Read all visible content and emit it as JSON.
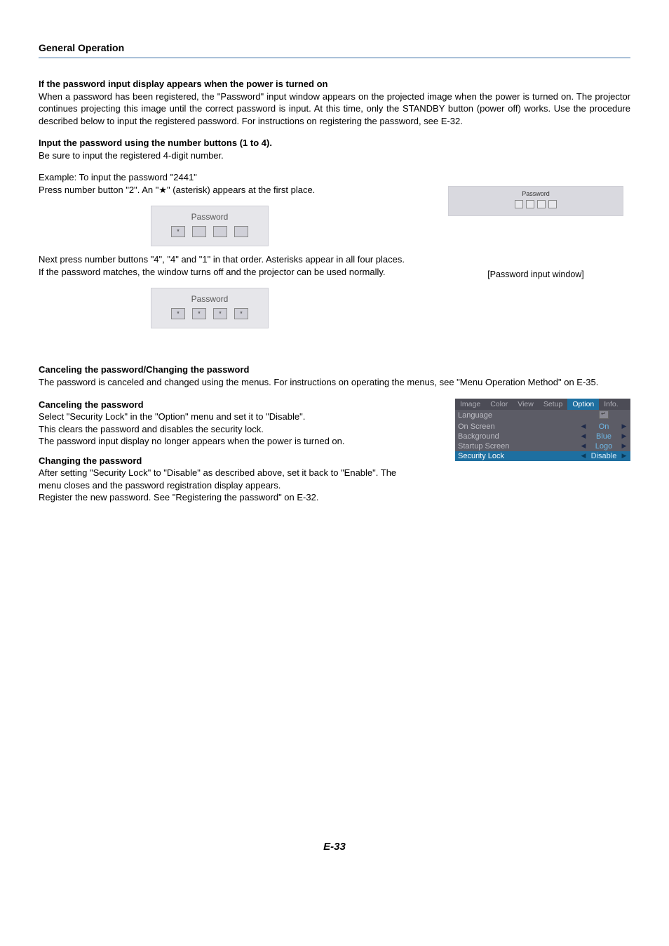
{
  "section_title": "General Operation",
  "h1": "If the password input display appears when the power is turned on",
  "p1": "When a password has been registered, the \"Password\" input window appears on the projected image when the power is turned on. The projector continues projecting this image until the correct password is input. At this time, only the STANDBY button (power off) works. Use the procedure described below to input the registered password. For instructions on registering the password, see E-32.",
  "h2": "Input the password using the number buttons (1 to 4).",
  "p2a": "Be sure to input the registered 4-digit number.",
  "p2b": "Example: To input the password \"2441\"",
  "p2c": "Press number button \"2\". An \"★\" (asterisk) appears at the first place.",
  "p2d": "Next press number buttons \"4\", \"4\" and \"1\" in that order. Asterisks appear in all four places.",
  "p2e": "If the password matches, the window turns off and the projector can be used normally.",
  "pw_label": "Password",
  "pw_small1_cells": [
    "*",
    "",
    "",
    ""
  ],
  "pw_small2_cells": [
    "*",
    "*",
    "*",
    "*"
  ],
  "pw_large_caption": "[Password input window]",
  "h3": "Canceling the password/Changing the password",
  "p3": "The password is canceled and changed using the menus. For instructions on operating the menus, see \"Menu Operation Method\" on E-35.",
  "h4": "Canceling the password",
  "p4a": "Select \"Security Lock\" in the \"Option\" menu and set it to \"Disable\".",
  "p4b": "This clears the password and disables the security lock.",
  "p4c": "The password input display no longer appears when the power is turned on.",
  "h5": "Changing the password",
  "p5a": "After setting \"Security Lock\" to \"Disable\" as described above, set it back to \"Enable\". The menu closes and the password registration display appears.",
  "p5b": "Register the new password. See \"Registering the password\" on E-32.",
  "menu": {
    "tabs": [
      "Image",
      "Color",
      "View",
      "Setup",
      "Option",
      "Info."
    ],
    "active_tab": "Option",
    "rows": [
      {
        "label": "Language",
        "value": "",
        "enter": true
      },
      {
        "label": "On Screen",
        "value": "On"
      },
      {
        "label": "Background",
        "value": "Blue"
      },
      {
        "label": "Startup Screen",
        "value": "Logo"
      },
      {
        "label": "Security Lock",
        "value": "Disable",
        "highlight": true
      }
    ]
  },
  "footer": "E-33"
}
